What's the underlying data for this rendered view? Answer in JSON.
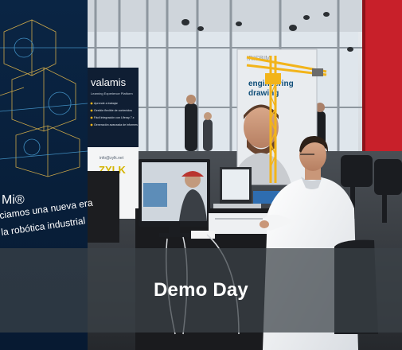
{
  "caption": {
    "title": "Demo Day"
  },
  "photo": {
    "left_banner": {
      "brand_mark": "Mi®",
      "line1": "ciamos una nueva era",
      "line2": "la robótica industrial"
    },
    "center_banner": {
      "logo": "valamis",
      "tagline": "Learning Experience Platform",
      "bullets": [
        "Aprende a trabajar",
        "Gestión flexible de contenidos",
        "Fácil integración con Liferay 7.x",
        "Generación avanzada de informes"
      ],
      "contact": "info@zylk.net",
      "brand": "ZYLK"
    },
    "right_banner": {
      "brand": "IRISBIM",
      "line1": "engineering",
      "line2": "drawing"
    }
  },
  "colors": {
    "red_wall": "#c8202a",
    "blue_banner": "#0d2a4a",
    "crane_yellow": "#f2b41a",
    "caption_band": "#3c4248"
  }
}
